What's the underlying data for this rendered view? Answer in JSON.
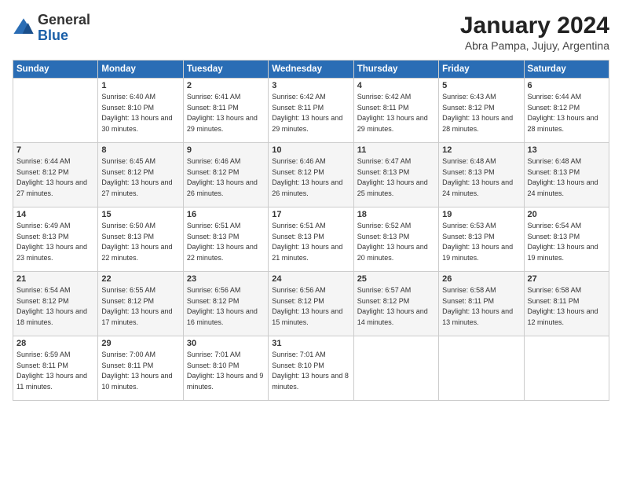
{
  "logo": {
    "general": "General",
    "blue": "Blue"
  },
  "header": {
    "month_year": "January 2024",
    "location": "Abra Pampa, Jujuy, Argentina"
  },
  "weekdays": [
    "Sunday",
    "Monday",
    "Tuesday",
    "Wednesday",
    "Thursday",
    "Friday",
    "Saturday"
  ],
  "weeks": [
    [
      {
        "day": "",
        "sunrise": "",
        "sunset": "",
        "daylight": ""
      },
      {
        "day": "1",
        "sunrise": "Sunrise: 6:40 AM",
        "sunset": "Sunset: 8:10 PM",
        "daylight": "Daylight: 13 hours and 30 minutes."
      },
      {
        "day": "2",
        "sunrise": "Sunrise: 6:41 AM",
        "sunset": "Sunset: 8:11 PM",
        "daylight": "Daylight: 13 hours and 29 minutes."
      },
      {
        "day": "3",
        "sunrise": "Sunrise: 6:42 AM",
        "sunset": "Sunset: 8:11 PM",
        "daylight": "Daylight: 13 hours and 29 minutes."
      },
      {
        "day": "4",
        "sunrise": "Sunrise: 6:42 AM",
        "sunset": "Sunset: 8:11 PM",
        "daylight": "Daylight: 13 hours and 29 minutes."
      },
      {
        "day": "5",
        "sunrise": "Sunrise: 6:43 AM",
        "sunset": "Sunset: 8:12 PM",
        "daylight": "Daylight: 13 hours and 28 minutes."
      },
      {
        "day": "6",
        "sunrise": "Sunrise: 6:44 AM",
        "sunset": "Sunset: 8:12 PM",
        "daylight": "Daylight: 13 hours and 28 minutes."
      }
    ],
    [
      {
        "day": "7",
        "sunrise": "Sunrise: 6:44 AM",
        "sunset": "Sunset: 8:12 PM",
        "daylight": "Daylight: 13 hours and 27 minutes."
      },
      {
        "day": "8",
        "sunrise": "Sunrise: 6:45 AM",
        "sunset": "Sunset: 8:12 PM",
        "daylight": "Daylight: 13 hours and 27 minutes."
      },
      {
        "day": "9",
        "sunrise": "Sunrise: 6:46 AM",
        "sunset": "Sunset: 8:12 PM",
        "daylight": "Daylight: 13 hours and 26 minutes."
      },
      {
        "day": "10",
        "sunrise": "Sunrise: 6:46 AM",
        "sunset": "Sunset: 8:12 PM",
        "daylight": "Daylight: 13 hours and 26 minutes."
      },
      {
        "day": "11",
        "sunrise": "Sunrise: 6:47 AM",
        "sunset": "Sunset: 8:13 PM",
        "daylight": "Daylight: 13 hours and 25 minutes."
      },
      {
        "day": "12",
        "sunrise": "Sunrise: 6:48 AM",
        "sunset": "Sunset: 8:13 PM",
        "daylight": "Daylight: 13 hours and 24 minutes."
      },
      {
        "day": "13",
        "sunrise": "Sunrise: 6:48 AM",
        "sunset": "Sunset: 8:13 PM",
        "daylight": "Daylight: 13 hours and 24 minutes."
      }
    ],
    [
      {
        "day": "14",
        "sunrise": "Sunrise: 6:49 AM",
        "sunset": "Sunset: 8:13 PM",
        "daylight": "Daylight: 13 hours and 23 minutes."
      },
      {
        "day": "15",
        "sunrise": "Sunrise: 6:50 AM",
        "sunset": "Sunset: 8:13 PM",
        "daylight": "Daylight: 13 hours and 22 minutes."
      },
      {
        "day": "16",
        "sunrise": "Sunrise: 6:51 AM",
        "sunset": "Sunset: 8:13 PM",
        "daylight": "Daylight: 13 hours and 22 minutes."
      },
      {
        "day": "17",
        "sunrise": "Sunrise: 6:51 AM",
        "sunset": "Sunset: 8:13 PM",
        "daylight": "Daylight: 13 hours and 21 minutes."
      },
      {
        "day": "18",
        "sunrise": "Sunrise: 6:52 AM",
        "sunset": "Sunset: 8:13 PM",
        "daylight": "Daylight: 13 hours and 20 minutes."
      },
      {
        "day": "19",
        "sunrise": "Sunrise: 6:53 AM",
        "sunset": "Sunset: 8:13 PM",
        "daylight": "Daylight: 13 hours and 19 minutes."
      },
      {
        "day": "20",
        "sunrise": "Sunrise: 6:54 AM",
        "sunset": "Sunset: 8:13 PM",
        "daylight": "Daylight: 13 hours and 19 minutes."
      }
    ],
    [
      {
        "day": "21",
        "sunrise": "Sunrise: 6:54 AM",
        "sunset": "Sunset: 8:12 PM",
        "daylight": "Daylight: 13 hours and 18 minutes."
      },
      {
        "day": "22",
        "sunrise": "Sunrise: 6:55 AM",
        "sunset": "Sunset: 8:12 PM",
        "daylight": "Daylight: 13 hours and 17 minutes."
      },
      {
        "day": "23",
        "sunrise": "Sunrise: 6:56 AM",
        "sunset": "Sunset: 8:12 PM",
        "daylight": "Daylight: 13 hours and 16 minutes."
      },
      {
        "day": "24",
        "sunrise": "Sunrise: 6:56 AM",
        "sunset": "Sunset: 8:12 PM",
        "daylight": "Daylight: 13 hours and 15 minutes."
      },
      {
        "day": "25",
        "sunrise": "Sunrise: 6:57 AM",
        "sunset": "Sunset: 8:12 PM",
        "daylight": "Daylight: 13 hours and 14 minutes."
      },
      {
        "day": "26",
        "sunrise": "Sunrise: 6:58 AM",
        "sunset": "Sunset: 8:11 PM",
        "daylight": "Daylight: 13 hours and 13 minutes."
      },
      {
        "day": "27",
        "sunrise": "Sunrise: 6:58 AM",
        "sunset": "Sunset: 8:11 PM",
        "daylight": "Daylight: 13 hours and 12 minutes."
      }
    ],
    [
      {
        "day": "28",
        "sunrise": "Sunrise: 6:59 AM",
        "sunset": "Sunset: 8:11 PM",
        "daylight": "Daylight: 13 hours and 11 minutes."
      },
      {
        "day": "29",
        "sunrise": "Sunrise: 7:00 AM",
        "sunset": "Sunset: 8:11 PM",
        "daylight": "Daylight: 13 hours and 10 minutes."
      },
      {
        "day": "30",
        "sunrise": "Sunrise: 7:01 AM",
        "sunset": "Sunset: 8:10 PM",
        "daylight": "Daylight: 13 hours and 9 minutes."
      },
      {
        "day": "31",
        "sunrise": "Sunrise: 7:01 AM",
        "sunset": "Sunset: 8:10 PM",
        "daylight": "Daylight: 13 hours and 8 minutes."
      },
      {
        "day": "",
        "sunrise": "",
        "sunset": "",
        "daylight": ""
      },
      {
        "day": "",
        "sunrise": "",
        "sunset": "",
        "daylight": ""
      },
      {
        "day": "",
        "sunrise": "",
        "sunset": "",
        "daylight": ""
      }
    ]
  ]
}
